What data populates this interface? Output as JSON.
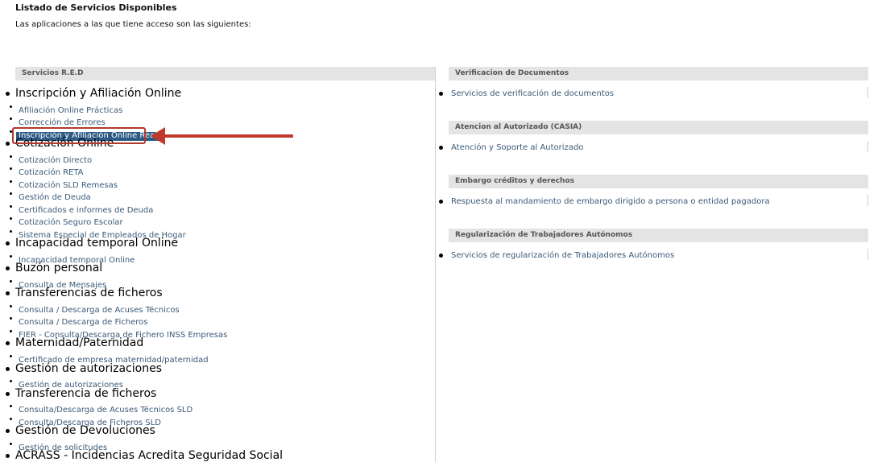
{
  "page": {
    "title": "Listado de Servicios Disponibles",
    "intro": "Las aplicaciones a las que tiene acceso son las siguientes:"
  },
  "left": {
    "header": "Servicios R.E.D",
    "groups": [
      {
        "title": "Inscripción y Afiliación Online",
        "items": [
          "Afiliación Online Prácticas",
          "Corrección de Errores",
          "Inscripción y Afiliación Online Real"
        ]
      },
      {
        "title": "Cotización Online",
        "items": [
          "Cotización Directo",
          "Cotización RETA",
          "Cotización SLD Remesas",
          "Gestión de Deuda",
          "Certificados e informes de Deuda",
          "Cotización Seguro Escolar",
          "Sistema Especial de Empleados de Hogar"
        ]
      },
      {
        "title": "Incapacidad temporal Online",
        "items": [
          "Incapacidad temporal Online"
        ]
      },
      {
        "title": "Buzón personal",
        "items": [
          "Consulta de Mensajes"
        ]
      },
      {
        "title": "Transferencias de ficheros",
        "items": [
          "Consulta / Descarga de Acuses Técnicos",
          "Consulta / Descarga de Ficheros",
          "FIER - Consulta/Descarga de Fichero INSS Empresas"
        ]
      },
      {
        "title": "Maternidad/Paternidad",
        "items": [
          "Certificado de empresa maternidad/paternidad"
        ]
      },
      {
        "title": "Gestión de autorizaciones",
        "items": [
          "Gestión de autorizaciones"
        ]
      },
      {
        "title": "Transferencia de ficheros",
        "items": [
          "Consulta/Descarga de Acuses Técnicos SLD",
          "Consulta/Descarga de Ficheros SLD"
        ]
      },
      {
        "title": "Gestión de Devoluciones",
        "items": [
          "Gestión de solicitudes"
        ]
      },
      {
        "title": "ACRASS - Incidencias Acredita Seguridad Social",
        "items": []
      }
    ]
  },
  "right": {
    "sections": [
      {
        "header": "Verificacion de Documentos",
        "item": "Servicios de verificación de documentos"
      },
      {
        "header": "Atencion al Autorizado (CASIA)",
        "item": "Atención y Soporte al Autorizado"
      },
      {
        "header": "Embargo créditos y derechos",
        "item": "Respuesta al mandamiento de embargo dirigido a persona o entidad pagadora"
      },
      {
        "header": "Regularización de Trabajadores Autónomos",
        "item": "Servicios de regularización de Trabajadores Autónomos"
      }
    ]
  },
  "annotation": {
    "arrow_color": "#c0392b",
    "box_color": "#b03a2e",
    "selected_item": "Inscripción y Afiliación Online Real"
  }
}
